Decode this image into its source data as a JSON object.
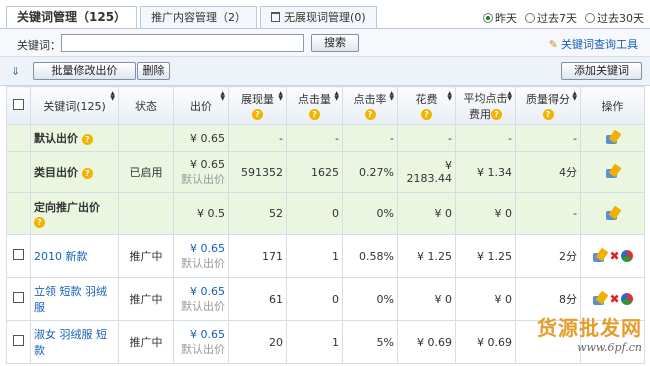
{
  "tabs": [
    {
      "label": "关键词管理（125）"
    },
    {
      "label": "推广内容管理（2）"
    },
    {
      "label": "无展现词管理(0)"
    }
  ],
  "periods": [
    {
      "label": "昨天",
      "selected": true
    },
    {
      "label": "过去7天",
      "selected": false
    },
    {
      "label": "过去30天",
      "selected": false
    }
  ],
  "search": {
    "label": "关键词：",
    "value": "",
    "button": "搜索",
    "tool_link": "关键词查询工具"
  },
  "actions": {
    "bulk_price": "批量修改出价",
    "delete": "删除",
    "add_keyword": "添加关键词"
  },
  "columns": {
    "keyword": "关键词(125)",
    "status": "状态",
    "bid": "出价",
    "impressions": "展现量",
    "clicks": "点击量",
    "ctr": "点击率",
    "cost": "花费",
    "avg_cpc_1": "平均点击",
    "avg_cpc_2": "费用",
    "quality": "质量得分",
    "ops": "操作"
  },
  "category_rows": [
    {
      "name": "默认出价",
      "status": "",
      "bid": "¥ 0.65",
      "bid_sub": "",
      "impressions": "-",
      "clicks": "-",
      "ctr": "-",
      "cost": "-",
      "avg_cpc": "-",
      "quality": "-"
    },
    {
      "name": "类目出价",
      "status": "已启用",
      "bid": "¥ 0.65",
      "bid_sub": "默认出价",
      "impressions": "591352",
      "clicks": "1625",
      "ctr": "0.27%",
      "cost": "¥ 2183.44",
      "avg_cpc": "¥ 1.34",
      "quality": "4分"
    },
    {
      "name": "定向推广出价",
      "status": "",
      "bid": "¥ 0.5",
      "bid_sub": "",
      "impressions": "52",
      "clicks": "0",
      "ctr": "0%",
      "cost": "¥ 0",
      "avg_cpc": "¥ 0",
      "quality": "-"
    }
  ],
  "keyword_rows": [
    {
      "keyword": "2010 新款",
      "status": "推广中",
      "bid": "¥ 0.65",
      "bid_sub": "默认出价",
      "impressions": "171",
      "clicks": "1",
      "ctr": "0.58%",
      "cost": "¥ 1.25",
      "avg_cpc": "¥ 1.25",
      "quality": "2分"
    },
    {
      "keyword": "立领 短款 羽绒服",
      "status": "推广中",
      "bid": "¥ 0.65",
      "bid_sub": "默认出价",
      "impressions": "61",
      "clicks": "0",
      "ctr": "0%",
      "cost": "¥ 0",
      "avg_cpc": "¥ 0",
      "quality": "8分"
    },
    {
      "keyword": "淑女 羽绒服 短款",
      "status": "推广中",
      "bid": "¥ 0.65",
      "bid_sub": "默认出价",
      "impressions": "20",
      "clicks": "1",
      "ctr": "5%",
      "cost": "¥ 0.69",
      "avg_cpc": "¥ 0.69",
      "quality": ""
    }
  ],
  "watermark": {
    "title": "货源批发网",
    "url": "www.6pf.cn"
  },
  "colors": {
    "link": "#1560b8",
    "category_bg": "#eaf6df",
    "accent_green": "#1a7f1a"
  }
}
